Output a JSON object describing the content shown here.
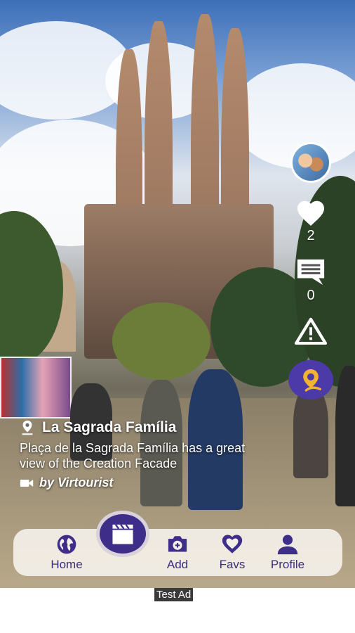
{
  "side_actions": {
    "like_count": "2",
    "comment_count": "0"
  },
  "caption": {
    "place_name": "La Sagrada Família",
    "description": "Plaça de la Sagrada Família has a great view of the Creation Facade",
    "author": "by Virtourist"
  },
  "nav": {
    "items": [
      {
        "label": "Home",
        "icon": "globe-icon"
      },
      {
        "label": "Add",
        "icon": "camera-add-icon"
      },
      {
        "label": "Favs",
        "icon": "heart-outline-icon"
      },
      {
        "label": "Profile",
        "icon": "person-icon"
      }
    ],
    "center_icon": "clapperboard-icon"
  },
  "ad": {
    "label": "Test Ad"
  },
  "colors": {
    "accent": "#3f2d8a",
    "nav_text": "#3a2f7a",
    "logo_yellow": "#f2b233"
  }
}
